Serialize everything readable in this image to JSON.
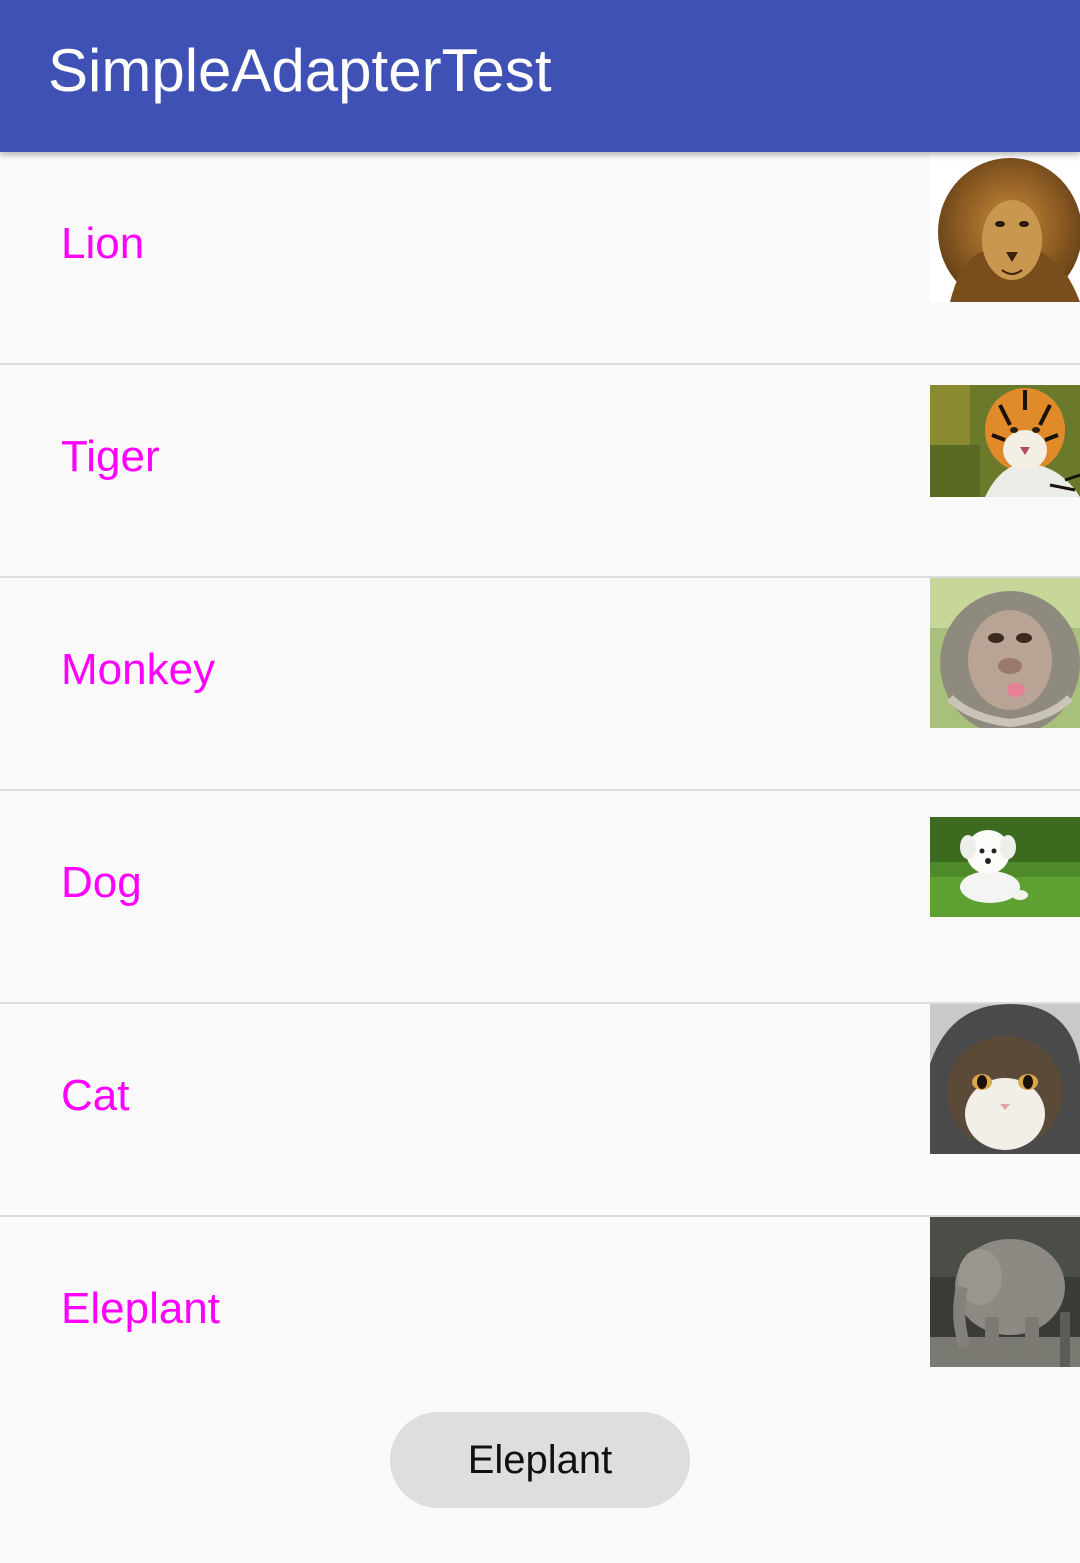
{
  "app_bar": {
    "title": "SimpleAdapterTest",
    "color": "#3f51b5"
  },
  "list": {
    "label_color": "#ff00ff",
    "items": [
      {
        "label": "Lion",
        "image": "lion-photo"
      },
      {
        "label": "Tiger",
        "image": "tiger-photo"
      },
      {
        "label": "Monkey",
        "image": "monkey-photo"
      },
      {
        "label": "Dog",
        "image": "dog-photo"
      },
      {
        "label": "Cat",
        "image": "cat-photo"
      },
      {
        "label": "Eleplant",
        "image": "elephant-photo"
      }
    ]
  },
  "toast": {
    "text": "Eleplant"
  }
}
